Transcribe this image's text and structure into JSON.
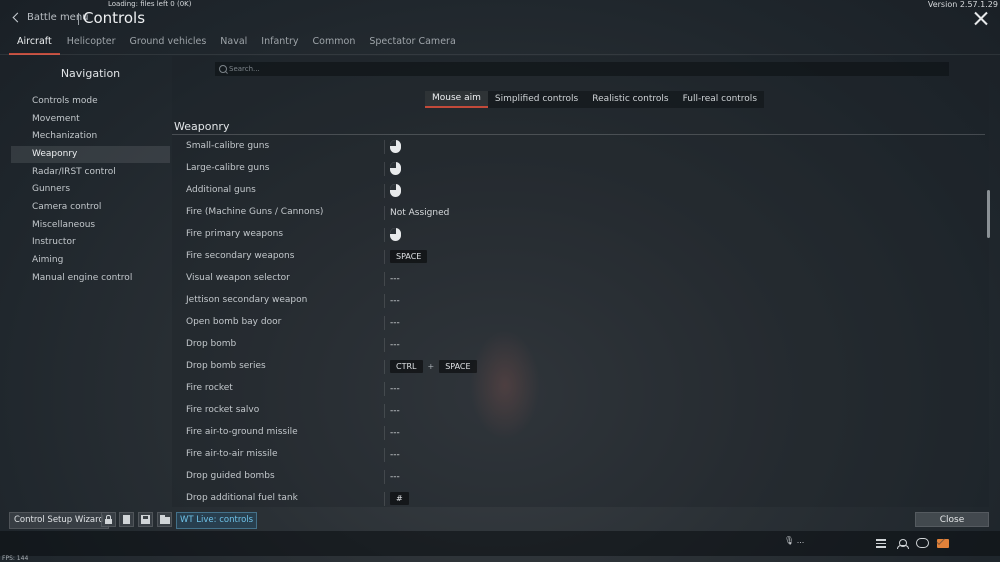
{
  "loading_text": "Loading: files left 0 (0K)",
  "version_text": "Version 2.57.1.29",
  "back_label": "Battle menu",
  "title": "Controls",
  "tabs": [
    "Aircraft",
    "Helicopter",
    "Ground vehicles",
    "Naval",
    "Infantry",
    "Common",
    "Spectator Camera"
  ],
  "nav": {
    "title": "Navigation",
    "items": [
      "Controls mode",
      "Movement",
      "Mechanization",
      "Weaponry",
      "Radar/IRST control",
      "Gunners",
      "Camera control",
      "Miscellaneous",
      "Instructor",
      "Aiming",
      "Manual engine control"
    ],
    "active_index": 3
  },
  "search": {
    "placeholder": "Search..."
  },
  "modes": [
    "Mouse aim",
    "Simplified controls",
    "Realistic controls",
    "Full-real controls"
  ],
  "section_title": "Weaponry",
  "rows": [
    {
      "label": "Small-calibre guns",
      "value": "mouse-left-icon"
    },
    {
      "label": "Large-calibre guns",
      "value": "mouse-left-icon"
    },
    {
      "label": "Additional guns",
      "value": "mouse-left-icon"
    },
    {
      "label": "Fire (Machine Guns / Cannons)",
      "value": "Not Assigned"
    },
    {
      "label": "Fire primary weapons",
      "value": "mouse-left-icon"
    },
    {
      "label": "Fire secondary weapons",
      "value": "SPACE"
    },
    {
      "label": "Visual weapon selector",
      "value": "---"
    },
    {
      "label": "Jettison secondary weapon",
      "value": "---"
    },
    {
      "label": "Open bomb bay door",
      "value": "---"
    },
    {
      "label": "Drop bomb",
      "value": "---"
    },
    {
      "label": "Drop bomb series",
      "value": "CTRL + SPACE"
    },
    {
      "label": "Fire rocket",
      "value": "---"
    },
    {
      "label": "Fire rocket salvo",
      "value": "---"
    },
    {
      "label": "Fire air-to-ground missile",
      "value": "---"
    },
    {
      "label": "Fire air-to-air missile",
      "value": "---"
    },
    {
      "label": "Drop guided bombs",
      "value": "---"
    },
    {
      "label": "Drop additional fuel tank",
      "value": "#"
    }
  ],
  "bottom": {
    "wizard_label": "Control Setup Wizard",
    "icons": [
      "lock-icon",
      "document-icon",
      "save-icon",
      "folder-icon"
    ],
    "live_label": "WT Live: controls",
    "close_label": "Close"
  },
  "status": {
    "mic_text": "...",
    "fps_text": "FPS: 144"
  },
  "colors": {
    "accent": "#c24a3a",
    "live": "#6fc2e8"
  }
}
